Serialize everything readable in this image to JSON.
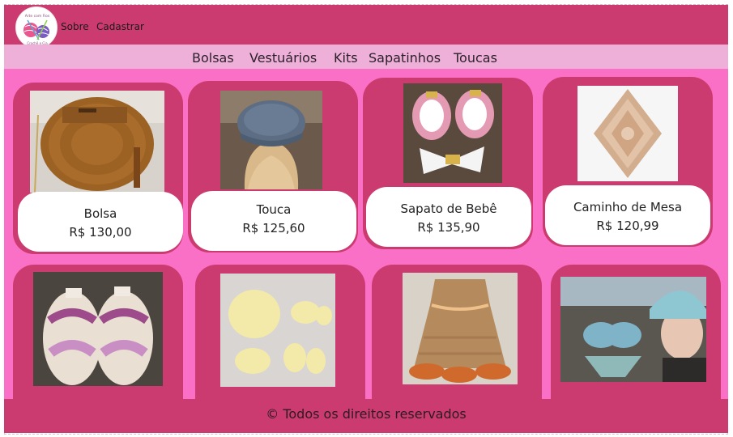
{
  "header": {
    "logo_text": "Arte com Fios Crochê e Cia",
    "links": [
      "Sobre",
      "Cadastrar"
    ]
  },
  "categories": [
    "Bolsas",
    "Vestuários",
    "Kits",
    "Sapatinhos",
    "Toucas"
  ],
  "products": [
    {
      "name": "Bolsa",
      "price": "R$ 130,00"
    },
    {
      "name": "Touca",
      "price": "R$ 125,60"
    },
    {
      "name": "Sapato de Bebê",
      "price": "R$ 135,90"
    },
    {
      "name": "Caminho de Mesa",
      "price": "R$ 120,99"
    }
  ],
  "footer": {
    "text": "© Todos os direitos reservados"
  },
  "colors": {
    "header": "#cc3b6f",
    "nav": "#eeb0d8",
    "content": "#fb70c7",
    "card": "#cc3b6f"
  }
}
